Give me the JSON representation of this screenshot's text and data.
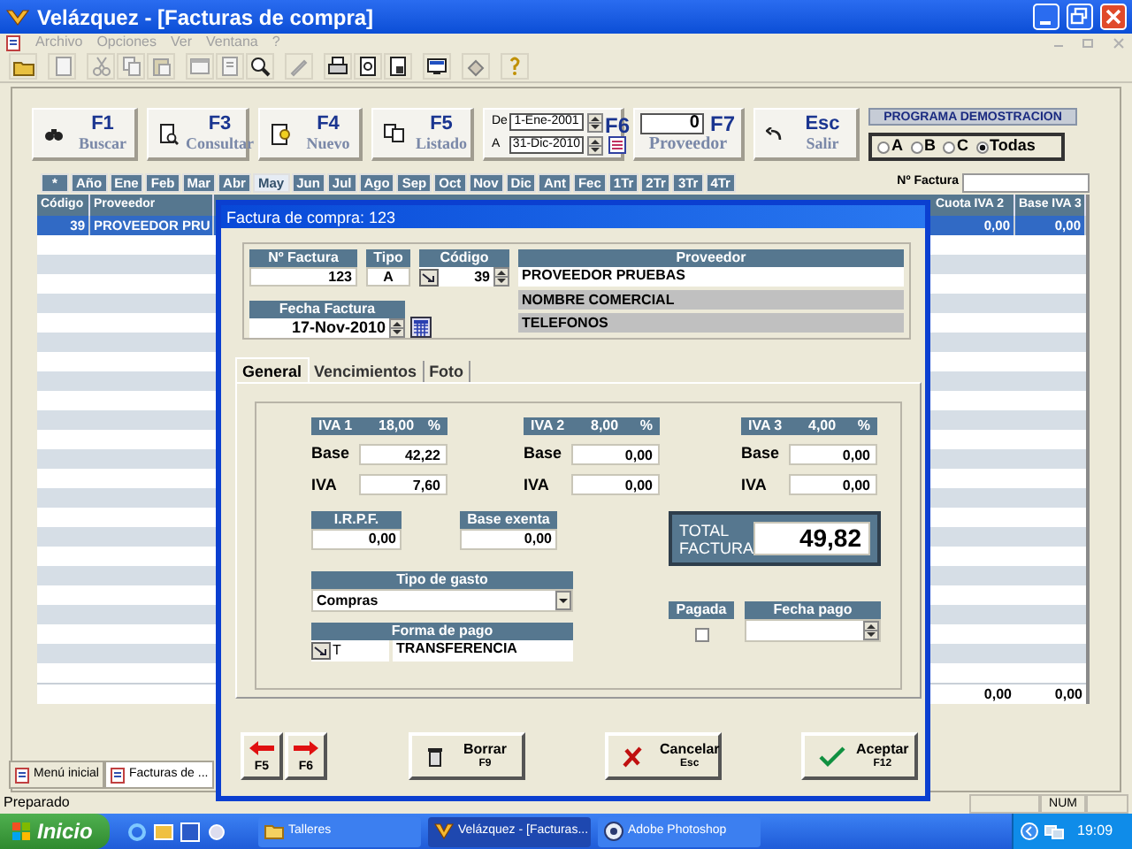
{
  "window": {
    "title": "Velázquez - [Facturas de compra]"
  },
  "menu": [
    "Archivo",
    "Opciones",
    "Ver",
    "Ventana",
    "?"
  ],
  "actions": [
    {
      "kind": "search",
      "key": "F1",
      "label": "Buscar"
    },
    {
      "kind": "consult",
      "key": "F3",
      "label": "Consultar"
    },
    {
      "kind": "new",
      "key": "F4",
      "label": "Nuevo"
    },
    {
      "kind": "list",
      "key": "F5",
      "label": "Listado"
    }
  ],
  "date_range": {
    "from_label": "De",
    "from": "1-Ene-2001",
    "to_label": "A",
    "to": "31-Dic-2010",
    "key": "F6"
  },
  "supplier_filter": {
    "value": "0",
    "key": "F7",
    "label": "Proveedor"
  },
  "exit": {
    "key": "Esc",
    "label": "Salir"
  },
  "demo": {
    "title": "PROGRAMA DEMOSTRACION",
    "options": [
      {
        "label": "A",
        "selected": false
      },
      {
        "label": "B",
        "selected": false
      },
      {
        "label": "C",
        "selected": false
      },
      {
        "label": "Todas",
        "selected": true
      }
    ]
  },
  "invoice_search": {
    "label": "Nº Factura"
  },
  "period_tabs": [
    {
      "label": "*",
      "selected": false
    },
    {
      "label": "Año",
      "selected": false
    },
    {
      "label": "Ene",
      "selected": false
    },
    {
      "label": "Feb",
      "selected": false
    },
    {
      "label": "Mar",
      "selected": false
    },
    {
      "label": "Abr",
      "selected": false
    },
    {
      "label": "May",
      "selected": true
    },
    {
      "label": "Jun",
      "selected": false
    },
    {
      "label": "Jul",
      "selected": false
    },
    {
      "label": "Ago",
      "selected": false
    },
    {
      "label": "Sep",
      "selected": false
    },
    {
      "label": "Oct",
      "selected": false
    },
    {
      "label": "Nov",
      "selected": false
    },
    {
      "label": "Dic",
      "selected": false
    },
    {
      "label": "Ant",
      "selected": false
    },
    {
      "label": "Fec",
      "selected": false
    },
    {
      "label": "1Tr",
      "selected": false
    },
    {
      "label": "2Tr",
      "selected": false
    },
    {
      "label": "3Tr",
      "selected": false
    },
    {
      "label": "4Tr",
      "selected": false
    }
  ],
  "table": {
    "columns_left": [
      "Código",
      "Proveedor"
    ],
    "columns_right": [
      "Cuota IVA 2",
      "Base IVA 3"
    ],
    "rows": [
      {
        "codigo": "39",
        "proveedor": "PROVEEDOR PRU",
        "cuota_iva_2": "0,00",
        "base_iva_3": "0,00",
        "selected": true
      }
    ],
    "totals": [
      "0,00",
      "0,00"
    ]
  },
  "dialog": {
    "title": "Factura de compra: 123",
    "invoice_no": {
      "label": "Nº Factura",
      "value": "123"
    },
    "type": {
      "label": "Tipo",
      "value": "A"
    },
    "code": {
      "label": "Código",
      "value": "39"
    },
    "supplier": {
      "label": "Proveedor",
      "name": "PROVEEDOR PRUEBAS",
      "trade_name": "NOMBRE COMERCIAL",
      "phones": "TELEFONOS"
    },
    "date": {
      "label": "Fecha Factura",
      "value": "17-Nov-2010"
    },
    "tabs": [
      {
        "label": "General",
        "selected": true
      },
      {
        "label": "Vencimientos",
        "selected": false
      },
      {
        "label": "Foto",
        "selected": false
      }
    ],
    "vat": [
      {
        "name": "IVA 1",
        "rate": "18,00",
        "unit": "%",
        "base_label": "Base",
        "base": "42,22",
        "vat_label": "IVA",
        "vat": "7,60"
      },
      {
        "name": "IVA 2",
        "rate": "8,00",
        "unit": "%",
        "base_label": "Base",
        "base": "0,00",
        "vat_label": "IVA",
        "vat": "0,00"
      },
      {
        "name": "IVA 3",
        "rate": "4,00",
        "unit": "%",
        "base_label": "Base",
        "base": "0,00",
        "vat_label": "IVA",
        "vat": "0,00"
      }
    ],
    "irpf": {
      "label": "I.R.P.F.",
      "value": "0,00"
    },
    "exempt": {
      "label": "Base exenta",
      "value": "0,00"
    },
    "total": {
      "label": "TOTAL FACTURA",
      "value": "49,82"
    },
    "expense_type": {
      "label": "Tipo de gasto",
      "value": "Compras"
    },
    "payment_method": {
      "label": "Forma de pago",
      "code": "T",
      "name": "TRANSFERENCIA"
    },
    "paid": {
      "label": "Pagada",
      "checked": false
    },
    "payment_date": {
      "label": "Fecha pago"
    },
    "buttons": [
      {
        "kind": "prev",
        "key": "F5"
      },
      {
        "kind": "next",
        "key": "F6"
      },
      {
        "kind": "delete",
        "label": "Borrar",
        "key": "F9"
      },
      {
        "kind": "cancel",
        "label": "Cancelar",
        "key": "Esc"
      },
      {
        "kind": "accept",
        "label": "Aceptar",
        "key": "F12"
      }
    ]
  },
  "mdi_tabs": [
    {
      "label": "Menú inicial",
      "selected": false
    },
    {
      "label": "Facturas de ...",
      "selected": true
    }
  ],
  "status_bar": {
    "text": "Preparado",
    "indicator": "NUM"
  },
  "taskbar": {
    "start": "Inicio",
    "tasks": [
      {
        "kind": "folder",
        "label": "Talleres",
        "selected": false
      },
      {
        "kind": "app",
        "label": "Velázquez - [Facturas...",
        "selected": true
      },
      {
        "kind": "photo",
        "label": "Adobe Photoshop",
        "selected": false
      }
    ],
    "clock": "19:09"
  }
}
